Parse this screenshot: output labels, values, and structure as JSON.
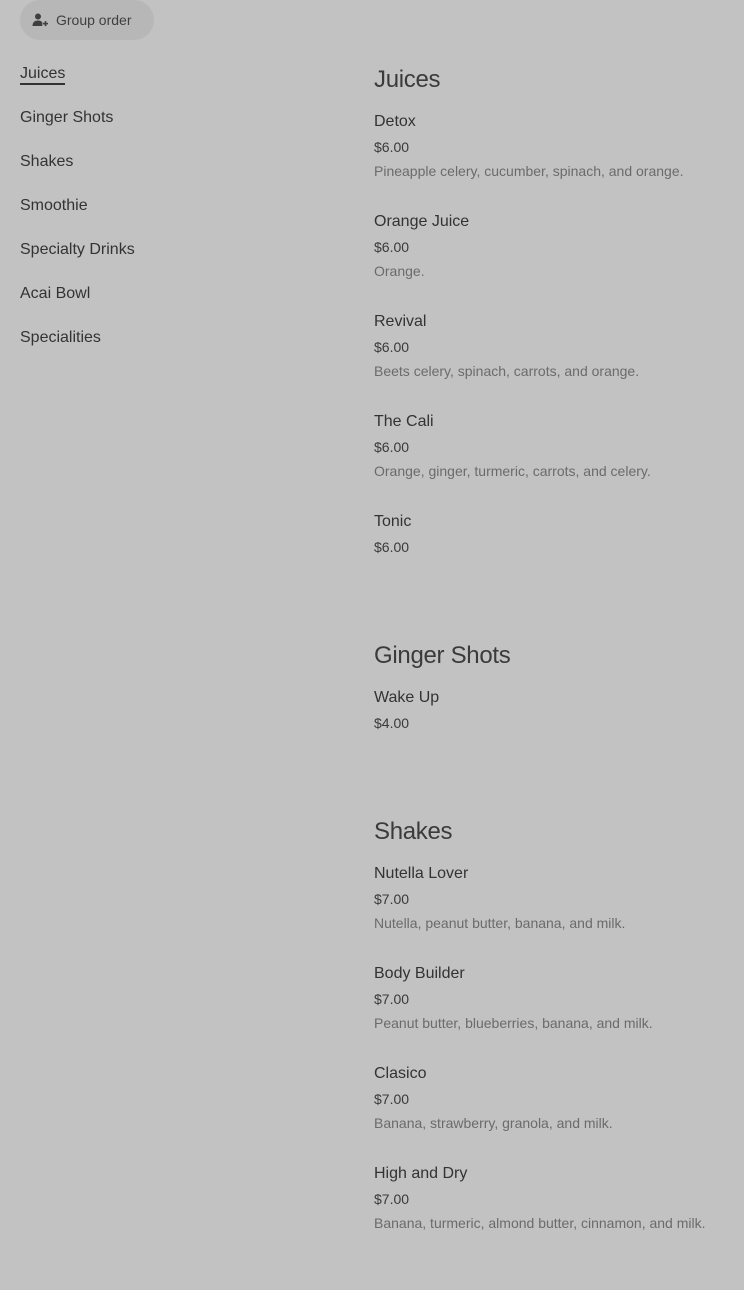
{
  "header": {
    "group_order_label": "Group order"
  },
  "sidebar": {
    "items": [
      {
        "label": "Juices",
        "active": true
      },
      {
        "label": "Ginger Shots"
      },
      {
        "label": "Shakes"
      },
      {
        "label": "Smoothie"
      },
      {
        "label": "Specialty Drinks"
      },
      {
        "label": "Acai Bowl"
      },
      {
        "label": "Specialities"
      }
    ]
  },
  "menu": {
    "sections": [
      {
        "title": "Juices",
        "items": [
          {
            "name": "Detox",
            "price": "$6.00",
            "description": "Pineapple celery, cucumber, spinach, and orange."
          },
          {
            "name": "Orange Juice",
            "price": "$6.00",
            "description": "Orange."
          },
          {
            "name": "Revival",
            "price": "$6.00",
            "description": "Beets celery, spinach, carrots, and orange."
          },
          {
            "name": "The Cali",
            "price": "$6.00",
            "description": "Orange, ginger, turmeric, carrots, and celery."
          },
          {
            "name": "Tonic",
            "price": "$6.00",
            "description": ""
          }
        ]
      },
      {
        "title": "Ginger Shots",
        "items": [
          {
            "name": "Wake Up",
            "price": "$4.00",
            "description": ""
          }
        ]
      },
      {
        "title": "Shakes",
        "items": [
          {
            "name": "Nutella Lover",
            "price": "$7.00",
            "description": "Nutella, peanut butter, banana, and milk."
          },
          {
            "name": "Body Builder",
            "price": "$7.00",
            "description": "Peanut butter, blueberries, banana, and milk."
          },
          {
            "name": "Clasico",
            "price": "$7.00",
            "description": "Banana, strawberry, granola, and milk."
          },
          {
            "name": "High and Dry",
            "price": "$7.00",
            "description": "Banana, turmeric, almond butter, cinnamon, and milk."
          }
        ]
      }
    ]
  },
  "icons": {
    "group_order": "person-add-icon"
  },
  "colors": {
    "background": "#c2c2c2",
    "button_bg": "#b7b7b7",
    "text": "#333333",
    "muted_text": "#6b6b6b"
  }
}
